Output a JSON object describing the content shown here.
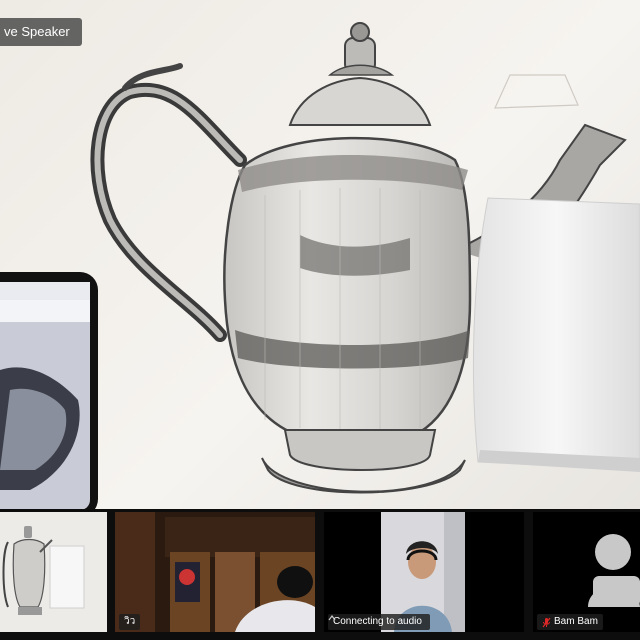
{
  "view_button": {
    "label": "ve Speaker"
  },
  "participants": [
    {
      "name": "",
      "active": true
    },
    {
      "name": "วิว",
      "active": false
    },
    {
      "name": "Connecting to audio",
      "active": false,
      "status_icon": "chevron-up-icon"
    },
    {
      "name": "Bam Bam",
      "active": false,
      "muted": true,
      "mic_color": "#e02828"
    }
  ],
  "colors": {
    "active_border": "#7bd84f",
    "paper": "#f4f2ee",
    "strip_bg": "#0d0d0d"
  }
}
